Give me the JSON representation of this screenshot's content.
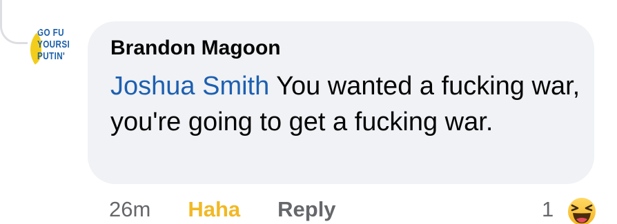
{
  "comment": {
    "author": "Brandon Magoon",
    "mention": "Joshua Smith",
    "text": " You wanted a fucking war, you're going to get a fucking war.",
    "avatar_lines": [
      "GO FU",
      "YOURSI",
      "PUTIN'"
    ]
  },
  "actions": {
    "timestamp": "26m",
    "haha_label": "Haha",
    "reply_label": "Reply"
  },
  "reactions": {
    "count": "1",
    "icon": "haha-emoji-icon"
  },
  "colors": {
    "bubble": "#f0f2f5",
    "mention": "#1d5fb0",
    "haha": "#f2b824",
    "muted": "#65676b"
  }
}
